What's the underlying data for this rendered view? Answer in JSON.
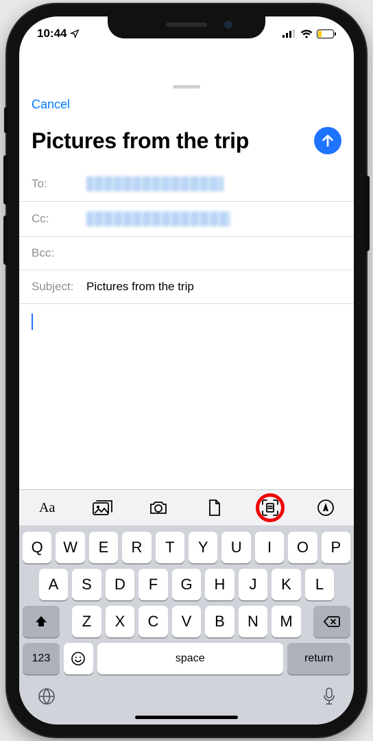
{
  "status": {
    "time": "10:44"
  },
  "nav": {
    "cancel": "Cancel"
  },
  "compose": {
    "title": "Pictures from the trip",
    "fields": {
      "to_label": "To:",
      "cc_label": "Cc:",
      "bcc_label": "Bcc:",
      "subject_label": "Subject:",
      "subject_value": "Pictures from the trip"
    }
  },
  "accessory": {
    "format": "Aa",
    "icons": {
      "photos": "photo-library-icon",
      "camera": "camera-icon",
      "file": "document-icon",
      "scan": "scan-document-icon",
      "markup": "markup-icon"
    }
  },
  "keyboard": {
    "row1": [
      "Q",
      "W",
      "E",
      "R",
      "T",
      "Y",
      "U",
      "I",
      "O",
      "P"
    ],
    "row2": [
      "A",
      "S",
      "D",
      "F",
      "G",
      "H",
      "J",
      "K",
      "L"
    ],
    "row3": [
      "Z",
      "X",
      "C",
      "V",
      "B",
      "N",
      "M"
    ],
    "n123": "123",
    "space": "space",
    "ret": "return"
  }
}
